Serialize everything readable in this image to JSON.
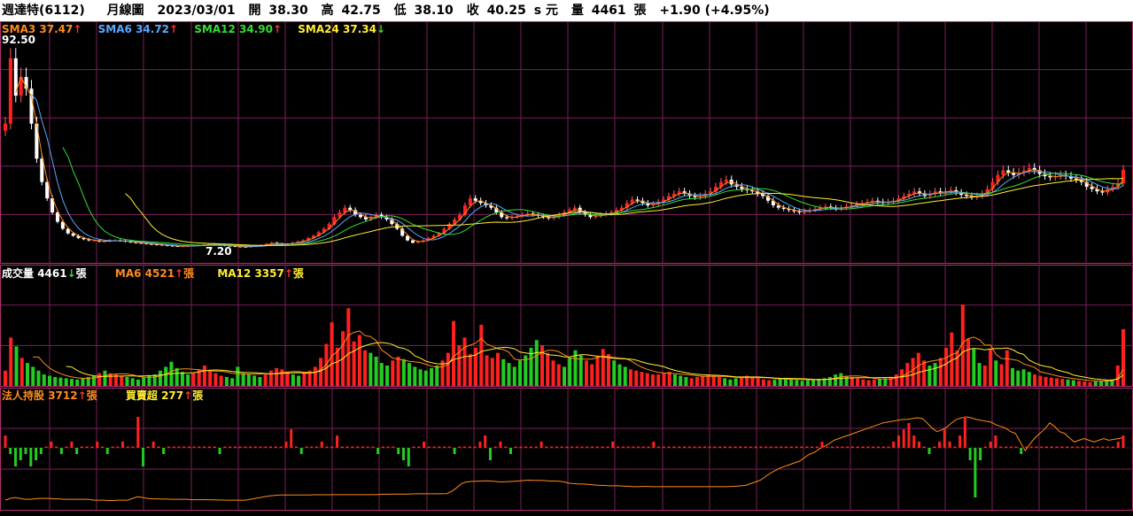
{
  "header": {
    "stock": "週達特(6112)",
    "period": "月線圖",
    "date": "2023/03/01",
    "open_label": "開",
    "open": "38.30",
    "high_label": "高",
    "high": "42.75",
    "low_label": "低",
    "low": "38.10",
    "close_label": "收",
    "close": "40.25",
    "close_suffix": "s 元",
    "vol_label": "量",
    "vol": "4461",
    "vol_unit": "張",
    "change": "+1.90 (+4.95%)"
  },
  "price_legend": [
    {
      "label": "SMA3",
      "value": "37.47",
      "arrow": "↑",
      "color": "#ff8c1a",
      "arrow_color": "#ff3030"
    },
    {
      "label": "SMA6",
      "value": "34.72",
      "arrow": "↑",
      "color": "#5aa8ff",
      "arrow_color": "#ff3030"
    },
    {
      "label": "SMA12",
      "value": "34.90",
      "arrow": "↑",
      "color": "#33dd33",
      "arrow_color": "#ff3030"
    },
    {
      "label": "SMA24",
      "value": "37.34",
      "arrow": "↓",
      "color": "#ffee33",
      "arrow_color": "#33dd33"
    }
  ],
  "price_axis": {
    "max_label": "92.50",
    "min_label": "7.20"
  },
  "volume_legend": [
    {
      "label": "成交量",
      "value": "4461",
      "arrow": "↓",
      "unit": "張",
      "color": "#ffffff",
      "arrow_color": "#33dd33"
    },
    {
      "label": "MA6",
      "value": "4521",
      "arrow": "↑",
      "unit": "張",
      "color": "#ff8c1a",
      "arrow_color": "#ff3030"
    },
    {
      "label": "MA12",
      "value": "3357",
      "arrow": "↑",
      "unit": "張",
      "color": "#ffee33",
      "arrow_color": "#ff3030"
    }
  ],
  "inst_legend": [
    {
      "label": "法人持股",
      "value": "3712",
      "arrow": "↑",
      "unit": "張",
      "color": "#ff8c1a",
      "arrow_color": "#ff3030"
    },
    {
      "label": "買賣超",
      "value": "277",
      "arrow": "↑",
      "unit": "張",
      "color": "#ffee33",
      "arrow_color": "#ff3030"
    }
  ],
  "colors": {
    "up": "#ff2020",
    "down": "#22cc22",
    "grid": "#7a1f5a",
    "border": "#b03070"
  },
  "chart_data": [
    {
      "type": "candlestick",
      "title": "月線圖",
      "ylim": [
        7.2,
        92.5
      ],
      "closes": [
        60,
        88,
        72,
        80,
        75,
        60,
        45,
        35,
        28,
        22,
        18,
        15,
        13,
        12,
        11,
        10.5,
        10,
        10,
        9.5,
        9.5,
        10,
        10,
        9.8,
        9.5,
        9.2,
        9,
        8.8,
        8.5,
        8.3,
        8.2,
        8,
        7.8,
        7.6,
        7.5,
        7.5,
        7.6,
        7.8,
        8,
        8.2,
        8.4,
        8.2,
        8,
        7.8,
        7.6,
        7.4,
        7.3,
        7.2,
        7.4,
        7.6,
        8,
        8.5,
        9,
        8.6,
        8.3,
        8.5,
        9,
        9.5,
        10,
        11,
        12,
        13.5,
        15,
        17,
        20,
        22,
        24,
        23,
        21,
        20,
        19,
        20,
        21,
        20,
        19,
        17,
        15,
        12,
        10,
        9,
        9.5,
        10,
        11,
        12,
        13,
        15,
        17,
        19,
        21,
        25,
        28,
        27,
        26,
        25,
        24,
        22,
        20,
        19.5,
        20,
        20.5,
        21,
        21.5,
        21,
        20.5,
        20,
        19.5,
        20,
        21,
        22,
        23,
        24,
        22,
        21,
        20,
        20.5,
        21,
        21.5,
        22,
        23,
        24,
        26,
        27.5,
        27,
        26,
        25,
        25.5,
        26.5,
        27.5,
        29,
        30,
        31,
        30,
        29,
        28.5,
        29,
        30,
        31,
        33,
        35,
        36,
        34,
        33,
        32,
        31.5,
        31,
        30,
        29,
        27,
        25,
        24,
        23.5,
        23,
        22.5,
        22,
        22.5,
        23,
        23.5,
        24,
        24.5,
        24,
        23.5,
        24,
        24.5,
        25,
        25.5,
        26,
        26.5,
        27,
        26.5,
        26,
        26.5,
        27,
        28,
        29,
        30,
        31,
        30,
        29,
        30,
        31,
        30.5,
        31,
        31.5,
        30.5,
        29.5,
        29,
        28.5,
        29,
        30,
        32,
        35,
        38,
        40,
        39,
        38,
        39,
        40,
        41,
        40,
        38.5,
        37.5,
        37,
        37.5,
        38,
        37.5,
        36.5,
        36,
        35,
        33,
        32,
        31,
        30.5,
        32,
        33,
        34.5,
        40.25
      ],
      "sma3": [],
      "sma6": [],
      "sma12": [],
      "sma24": []
    },
    {
      "type": "bar",
      "title": "成交量",
      "volumes": [
        1200,
        3800,
        3100,
        2200,
        1800,
        1500,
        1200,
        900,
        800,
        700,
        650,
        600,
        550,
        500,
        600,
        700,
        800,
        1000,
        1200,
        1000,
        900,
        800,
        700,
        600,
        500,
        650,
        800,
        900,
        1200,
        1500,
        1900,
        1400,
        1100,
        900,
        1000,
        1300,
        1600,
        1200,
        1000,
        800,
        700,
        600,
        1500,
        1000,
        900,
        800,
        700,
        900,
        1200,
        1400,
        1300,
        1100,
        900,
        800,
        1000,
        1200,
        1500,
        2200,
        3300,
        5000,
        3000,
        4300,
        6100,
        3500,
        4000,
        2800,
        2600,
        2300,
        1800,
        1600,
        2000,
        2300,
        2100,
        1800,
        1500,
        1300,
        1200,
        1400,
        1600,
        2000,
        2600,
        5100,
        3200,
        3800,
        2500,
        3000,
        4800,
        2400,
        2200,
        2600,
        2100,
        1800,
        1500,
        2000,
        2400,
        3000,
        3600,
        3200,
        2600,
        2000,
        1700,
        1500,
        2200,
        2800,
        2400,
        2000,
        1700,
        2300,
        2900,
        2500,
        2000,
        1700,
        1500,
        1300,
        1200,
        1100,
        1000,
        900,
        900,
        1000,
        1100,
        900,
        800,
        700,
        600,
        700,
        800,
        900,
        800,
        700,
        600,
        500,
        600,
        700,
        800,
        700,
        600,
        500,
        450,
        500,
        550,
        600,
        500,
        450,
        400,
        450,
        500,
        550,
        600,
        700,
        900,
        1000,
        800,
        700,
        600,
        500,
        450,
        500,
        550,
        600,
        700,
        900,
        1300,
        1800,
        2200,
        2600,
        2000,
        1600,
        1800,
        2200,
        3000,
        4200,
        2800,
        6400,
        3700,
        2900,
        1800,
        1600,
        2900,
        2000,
        1700,
        2800,
        1400,
        1200,
        1300,
        1100,
        900,
        800,
        700,
        650,
        600,
        550,
        500,
        450,
        400,
        350,
        300,
        350,
        400,
        450,
        500,
        1600,
        4461
      ],
      "ylim": [
        0,
        8000
      ]
    },
    {
      "type": "line+bar",
      "title": "法人持股 / 買賣超",
      "holding": [
        3,
        5,
        6,
        5,
        4,
        4,
        4.5,
        5,
        5,
        5,
        4.5,
        4.5,
        4,
        4,
        4,
        4,
        4,
        4,
        3,
        3,
        3,
        2.5,
        2.5,
        3,
        3,
        3,
        5,
        7,
        6,
        5,
        4.5,
        4.5,
        4.2,
        4.2,
        4,
        4,
        4,
        4,
        3.5,
        3.5,
        3.5,
        3.5,
        3.5,
        3.2,
        3.2,
        3,
        3,
        3,
        3,
        3,
        4,
        5,
        6,
        7,
        8,
        8.5,
        9,
        9,
        9,
        9,
        9,
        9,
        9,
        9.2,
        9.2,
        9.2,
        9.2,
        9.3,
        9.3,
        9.3,
        9.3,
        9.3,
        9.3,
        9.3,
        9.3,
        9.3,
        9.5,
        9.8,
        9.8,
        10,
        10,
        10,
        10,
        10.2,
        10.3,
        10.3,
        10.3,
        10.3,
        10.3,
        10.3,
        10.5,
        13,
        17,
        22,
        24,
        24.5,
        24.8,
        25,
        25.2,
        25,
        24.5,
        24,
        24.2,
        24.5,
        24.8,
        25.2,
        25.8,
        26,
        25.8,
        25.8,
        25.5,
        25,
        25,
        24.8,
        24,
        22.5,
        22,
        21.5,
        21.5,
        21,
        20.5,
        20,
        20,
        19.5,
        19.5,
        19.5,
        19.2,
        19,
        18.5,
        18.5,
        18.8,
        18.8,
        18.5,
        18.5,
        18.5,
        18.5,
        18.5,
        18.5,
        18.5,
        18.5,
        18.5,
        18.5,
        18.5,
        18.5,
        18.5,
        18.5,
        18.5,
        18.5,
        18.8,
        19,
        19.5,
        20,
        22,
        24,
        26,
        30,
        34,
        37,
        40,
        42,
        44,
        46,
        48,
        52,
        56,
        58,
        62,
        65,
        68,
        72,
        74,
        76,
        78,
        80,
        82,
        84,
        86,
        88,
        90,
        92,
        93,
        94,
        95,
        96,
        96,
        97,
        98,
        97,
        92,
        86,
        82,
        84,
        87,
        92,
        96,
        98,
        99,
        98,
        96,
        95,
        94,
        93,
        90,
        88,
        86,
        82,
        80,
        70,
        60,
        68,
        75,
        80,
        85,
        92,
        88,
        82,
        80,
        75,
        70,
        72,
        74,
        72,
        70,
        72,
        74,
        72,
        73,
        74,
        75
      ],
      "net": [
        2,
        -1,
        -3,
        -2,
        -1,
        -3,
        -2,
        -1,
        0,
        1,
        0,
        -1,
        0,
        1,
        -1,
        0,
        0,
        0,
        1,
        0,
        -1,
        0,
        0,
        1,
        0,
        0,
        5,
        -3,
        0,
        1,
        0,
        -1,
        0,
        0,
        0,
        0,
        0,
        0,
        0,
        0,
        0,
        0,
        -1,
        0,
        0,
        0,
        0,
        0,
        0,
        0,
        0,
        0,
        0,
        0,
        0,
        1,
        3,
        0,
        -1,
        0,
        0,
        0,
        1,
        0,
        0,
        2,
        0,
        0,
        0,
        0,
        0,
        0,
        0,
        -1,
        0,
        0,
        0,
        -1,
        -2,
        -3,
        0,
        0,
        1,
        0,
        0,
        0,
        0,
        0,
        -1,
        0,
        0,
        0,
        0,
        1,
        2,
        -2,
        0,
        1,
        0,
        -1,
        0,
        0,
        0,
        0,
        0,
        1,
        0,
        0,
        0,
        0,
        0,
        0,
        0,
        0,
        0,
        0,
        0,
        0,
        0,
        1,
        0,
        0,
        0,
        0,
        0,
        0,
        0,
        1,
        0,
        0,
        0,
        0,
        0,
        0,
        0,
        0,
        0,
        0,
        0,
        0,
        0,
        0,
        0,
        0,
        0,
        0,
        0,
        0,
        0,
        0,
        0,
        0,
        0,
        0,
        0,
        0,
        0,
        0,
        0,
        0,
        1,
        0,
        0,
        0,
        0,
        0,
        0,
        0,
        0,
        0,
        0,
        0,
        0,
        0,
        1,
        2,
        3,
        4,
        2,
        1,
        0,
        -1,
        0,
        1,
        3,
        1,
        0,
        2,
        5,
        -2,
        -8,
        -2,
        0,
        1,
        2,
        0,
        0,
        0,
        0,
        -1,
        0,
        0,
        0,
        0,
        0,
        0,
        0,
        0,
        0,
        0,
        0,
        0,
        0,
        0,
        0,
        0,
        0,
        0,
        1,
        2
      ]
    }
  ]
}
